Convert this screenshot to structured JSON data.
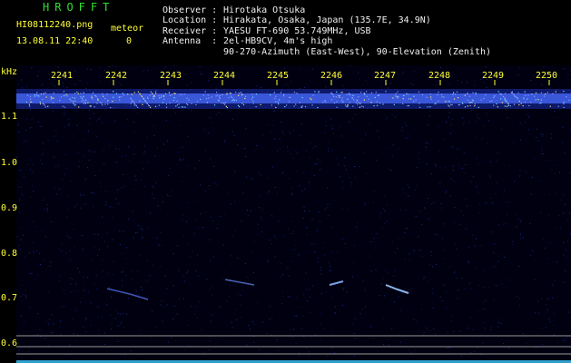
{
  "header": {
    "app_title": "HROFFT",
    "filename": "HI08112240.png",
    "meteor_label": "meteor",
    "timestamp": "13.08.11 22:40",
    "meteor_count": "0"
  },
  "station": {
    "observer_label": "Observer :",
    "observer_value": "Hirotaka Otsuka",
    "location_label": "Location :",
    "location_value": "Hirakata, Osaka, Japan (135.7E, 34.9N)",
    "receiver_label": "Receiver :",
    "receiver_value": "YAESU FT-690 53.749MHz, USB",
    "antenna_label": "Antenna  :",
    "antenna_value": "2el-HB9CV, 4m's high",
    "antenna_value_2": "90-270-Azimuth (East-West), 90-Elevation (Zenith)"
  },
  "plot": {
    "y_unit": "kHz",
    "time_ticks": [
      "2241",
      "2242",
      "2243",
      "2244",
      "2245",
      "2246",
      "2247",
      "2248",
      "2249",
      "2250"
    ],
    "freq_ticks": [
      "1.1",
      "1.0",
      "0.9",
      "0.8",
      "0.7",
      "0.6"
    ]
  },
  "colors": {
    "background": "#000000",
    "noise_band": "#3a5cff",
    "header_yellow": "#ffff33",
    "title_green": "#2fe02f",
    "tick_color": "#ffff33"
  }
}
